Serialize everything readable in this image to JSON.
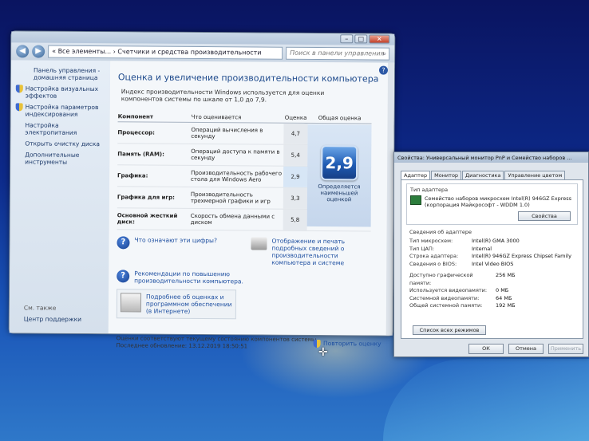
{
  "main_window": {
    "address": "« Все элементы... › Счетчики и средства производительности",
    "search_placeholder": "Поиск в панели управления",
    "sidebar": {
      "items": [
        "Панель управления - домашняя страница",
        "Настройка визуальных эффектов",
        "Настройка параметров индексирования",
        "Настройка электропитания",
        "Открыть очистку диска",
        "Дополнительные инструменты"
      ],
      "see_also": "См. также",
      "support": "Центр поддержки"
    },
    "title": "Оценка и увеличение производительности компьютера",
    "intro": "Индекс производительности Windows используется для оценки компонентов системы по шкале от 1,0 до 7,9.",
    "table": {
      "headers": [
        "Компонент",
        "Что оценивается",
        "Оценка",
        "Общая оценка"
      ],
      "rows": [
        {
          "component": "Процессор:",
          "what": "Операций вычисления в секунду",
          "score": "4,7"
        },
        {
          "component": "Память (RAM):",
          "what": "Операций доступа к памяти в секунду",
          "score": "5,4"
        },
        {
          "component": "Графика:",
          "what": "Производительность рабочего стола для Windows Aero",
          "score": "2,9"
        },
        {
          "component": "Графика для игр:",
          "what": "Производительность трехмерной графики и игр",
          "score": "3,3"
        },
        {
          "component": "Основной жесткий диск:",
          "what": "Скорость обмена данными с диском",
          "score": "5,8"
        }
      ],
      "base_score": "2,9",
      "base_caption": "Определяется наименьшей оценкой"
    },
    "links": {
      "what_mean": "Что означают эти цифры?",
      "print": "Отображение и печать подробных сведений о производительности компьютера и системе",
      "tips": "Рекомендации по повышению производительности компьютера.",
      "more": "Подробнее об оценках и программном обеспечении (в Интернете)"
    },
    "footer": {
      "status": "Оценки соответствуют текущему состоянию компонентов системы",
      "last_update": "Последнее обновление: 13.12.2019 18:50:51",
      "rerun": "Повторить оценку"
    }
  },
  "props_dialog": {
    "title": "Свойства: Универсальный монитор PnP и Семейство наборов ...",
    "tabs": [
      "Адаптер",
      "Монитор",
      "Диагностика",
      "Управление цветом"
    ],
    "adapter_type_label": "Тип адаптера",
    "adapter_name": "Семейство наборов микросхем Intel(R) 946GZ Express (корпорация Майкрософт - WDDM 1.0)",
    "properties_button": "Свойства",
    "adapter_info_label": "Сведения об адаптере",
    "info": [
      {
        "k": "Тип микросхем:",
        "v": "Intel(R) GMA 3000"
      },
      {
        "k": "Тип ЦАП:",
        "v": "Internal"
      },
      {
        "k": "Строка адаптера:",
        "v": "Intel(R) 946GZ Express Chipset Family"
      },
      {
        "k": "Сведения о BIOS:",
        "v": "Intel Video BIOS"
      }
    ],
    "memory": [
      {
        "k": "Доступно графической памяти:",
        "v": "256 МБ"
      },
      {
        "k": "Используется видеопамяти:",
        "v": "0 МБ"
      },
      {
        "k": "Системной видеопамяти:",
        "v": "64 МБ"
      },
      {
        "k": "Общей системной памяти:",
        "v": "192 МБ"
      }
    ],
    "modes_button": "Список всех режимов",
    "buttons": {
      "ok": "ОК",
      "cancel": "Отмена",
      "apply": "Применить"
    }
  }
}
